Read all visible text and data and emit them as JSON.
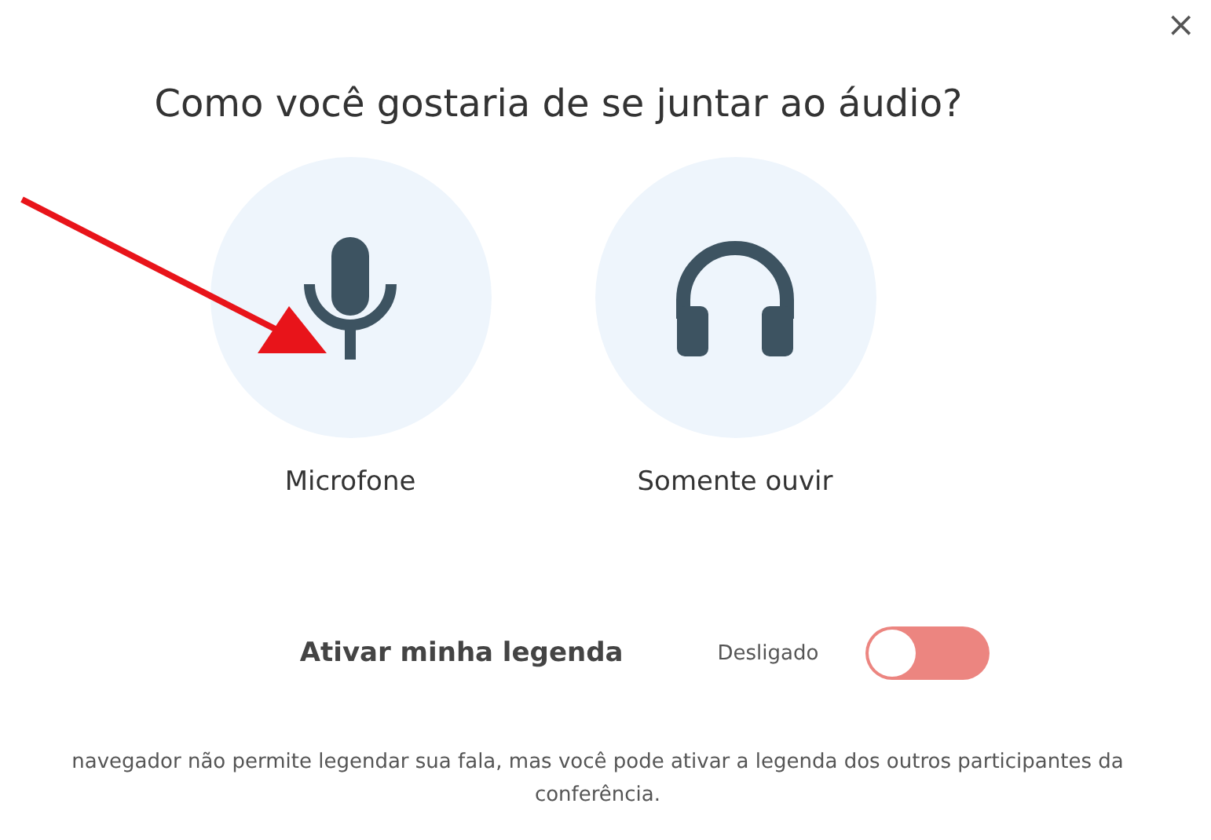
{
  "close_button": "×",
  "title": "Como você gostaria de se juntar ao áudio?",
  "options": [
    {
      "label": "Microfone",
      "kind": "microphone"
    },
    {
      "label": "Somente ouvir",
      "kind": "headphones"
    }
  ],
  "caption_toggle": {
    "label": "Ativar minha legenda",
    "state_text": "Desligado",
    "on": false
  },
  "note": "navegador não permite legendar sua fala, mas você pode ativar a legenda dos outros participantes da conferência."
}
